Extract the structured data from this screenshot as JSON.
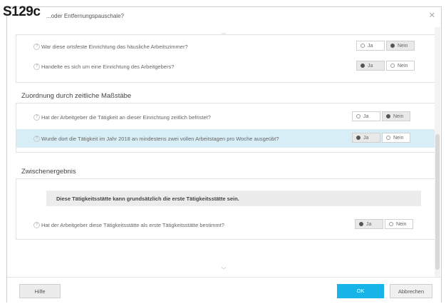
{
  "overlay_label": "S129c",
  "window": {
    "title": "...oder Entfernungspauschale?",
    "close_icon": "close-icon"
  },
  "section1": {
    "rows": [
      {
        "question": "War diese ortsfeste Einrichtung das häusliche Arbeitszimmer?",
        "yes": "Ja",
        "no": "Nein",
        "selected": "no"
      },
      {
        "question": "Handelte es sich um eine Einrichtung des Arbeitgebers?",
        "yes": "Ja",
        "no": "Nein",
        "selected": "yes"
      }
    ]
  },
  "section2": {
    "heading": "Zuordnung durch zeitliche Maßstäbe",
    "rows": [
      {
        "question": "Hat der Arbeitgeber die Tätigkeit an dieser Einrichtung zeitlich befristet?",
        "yes": "Ja",
        "no": "Nein",
        "selected": "no"
      },
      {
        "question": "Wurde dort die Tätigkeit im Jahr 2018 an mindestens zwei vollen Arbeitstagen pro Woche ausgeübt?",
        "yes": "Ja",
        "no": "Nein",
        "selected": "yes"
      }
    ]
  },
  "section3": {
    "heading": "Zwischenergebnis",
    "info": "Diese Tätigkeitsstätte kann grundsätzlich die erste Tätigkeitsstätte sein.",
    "rows": [
      {
        "question": "Hat der Arbeitgeber diese Tätigkeitsstätte als erste Tätigkeitsstätte bestimmt?",
        "yes": "Ja",
        "no": "Nein",
        "selected": "yes"
      }
    ]
  },
  "footer": {
    "help": "Hilfe",
    "ok": "OK",
    "cancel": "Abbrechen"
  },
  "colors": {
    "accent": "#17b4e8",
    "highlight_row": "#d8eef6"
  }
}
